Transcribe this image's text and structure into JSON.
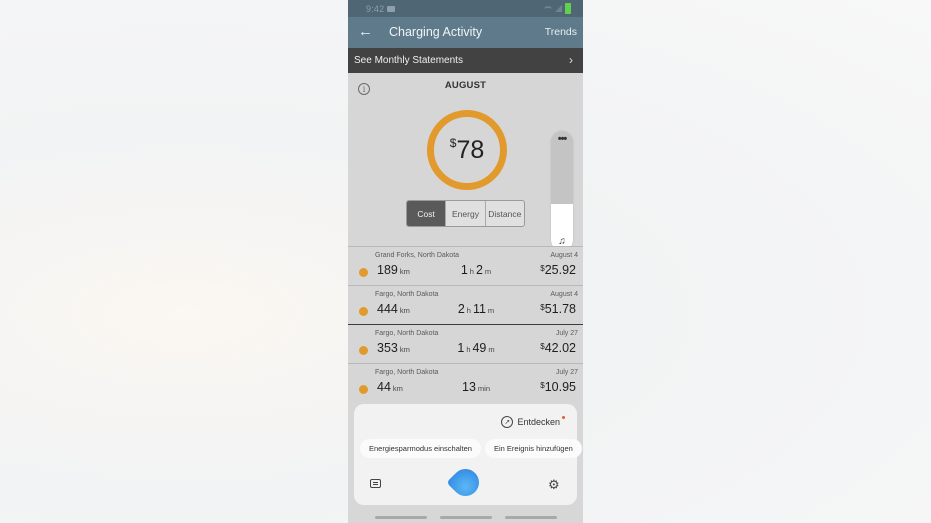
{
  "status_bar": {
    "time": "9:42"
  },
  "app_bar": {
    "title": "Charging Activity",
    "back_icon": "arrow-left-icon",
    "trends_label": "Trends"
  },
  "statements_link": {
    "label": "See Monthly Statements",
    "chevron": "›"
  },
  "summary": {
    "month": "AUGUST",
    "currency": "$",
    "total": "78",
    "ring_color": "#e29a2c",
    "tabs": [
      {
        "label": "Cost",
        "active": true
      },
      {
        "label": "Energy",
        "active": false
      },
      {
        "label": "Distance",
        "active": false
      }
    ]
  },
  "volume_panel": {
    "menu_label": "•••",
    "level_percent": 39
  },
  "sessions": [
    {
      "location": "Grand Forks, North Dakota",
      "date": "August 4",
      "distance": "189",
      "distance_unit": "km",
      "hours": "1",
      "minutes": "2",
      "h_unit": "h",
      "m_unit": "m",
      "currency": "$",
      "cost": "25.92"
    },
    {
      "location": "Fargo, North Dakota",
      "date": "August 4",
      "distance": "444",
      "distance_unit": "km",
      "hours": "2",
      "minutes": "11",
      "h_unit": "h",
      "m_unit": "m",
      "currency": "$",
      "cost": "51.78"
    },
    {
      "location": "Fargo, North Dakota",
      "date": "July 27",
      "distance": "353",
      "distance_unit": "km",
      "hours": "1",
      "minutes": "49",
      "h_unit": "h",
      "m_unit": "m",
      "currency": "$",
      "cost": "42.02"
    },
    {
      "location": "Fargo, North Dakota",
      "date": "July 27",
      "distance": "44",
      "distance_unit": "km",
      "minutes": "13",
      "min_unit": "min",
      "currency": "$",
      "cost": "10.95"
    }
  ],
  "assistant": {
    "discover_label": "Entdecken",
    "suggestions": [
      "Energiesparmodus einschalten",
      "Ein Ereignis hinzufügen"
    ],
    "gear_glyph": "⚙"
  }
}
